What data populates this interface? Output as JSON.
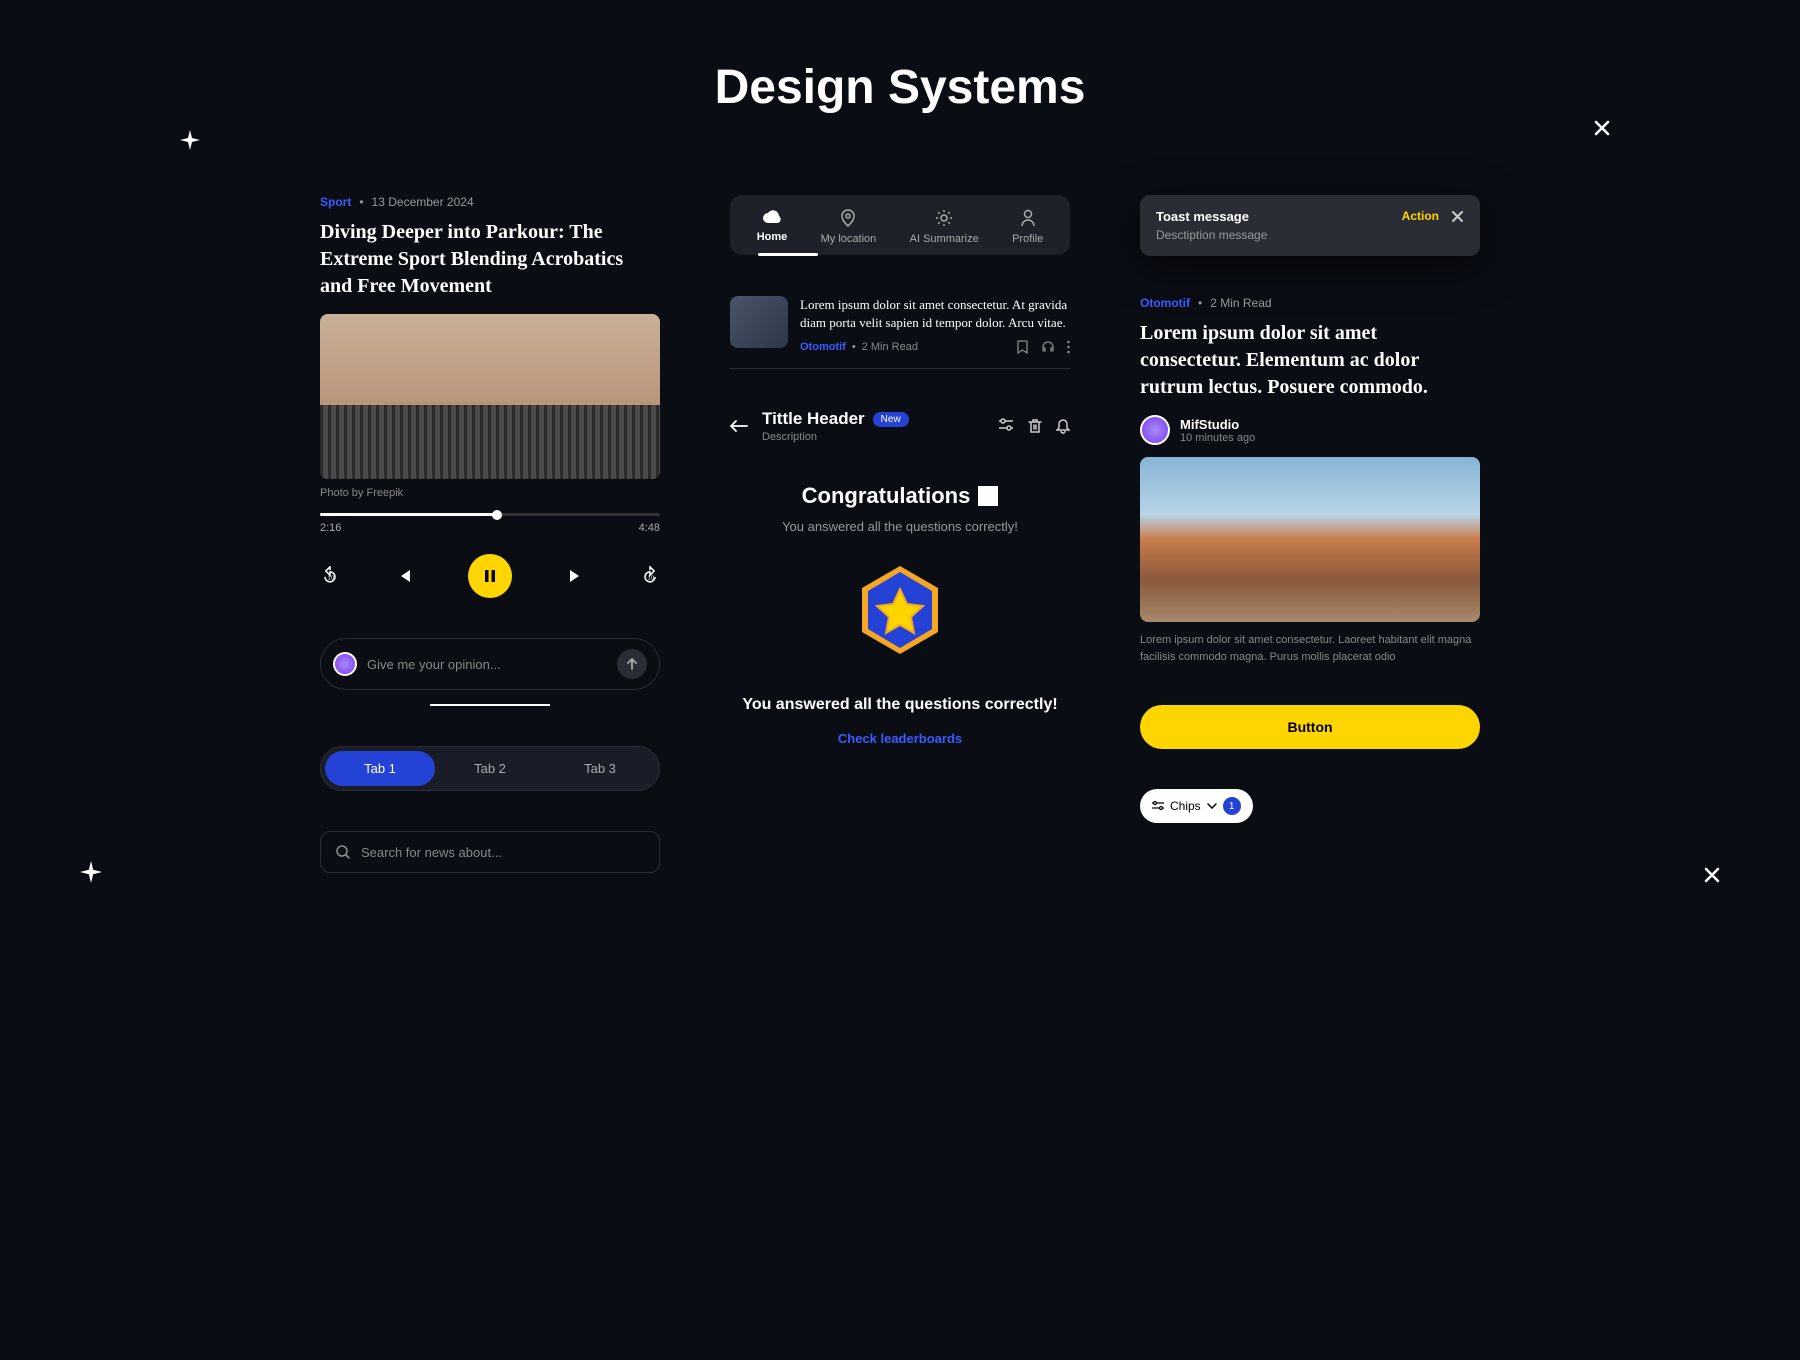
{
  "page": {
    "title": "Design Systems"
  },
  "article1": {
    "category": "Sport",
    "date": "13 December 2024",
    "title": "Diving Deeper into Parkour: The Extreme Sport Blending Acrobatics and Free Movement",
    "caption": "Photo by Freepik"
  },
  "player": {
    "elapsed": "2:16",
    "duration": "4:48"
  },
  "chat": {
    "placeholder": "Give me your opinion..."
  },
  "tabs": {
    "t1": "Tab 1",
    "t2": "Tab 2",
    "t3": "Tab 3"
  },
  "search": {
    "placeholder": "Search for news about..."
  },
  "nav": {
    "home": "Home",
    "location": "My location",
    "ai": "AI Summarize",
    "profile": "Profile"
  },
  "listItem": {
    "title": "Lorem ipsum dolor sit amet consectetur. At gravida diam porta velit sapien id tempor dolor. Arcu vitae.",
    "category": "Otomotif",
    "readtime": "2 Min Read"
  },
  "header": {
    "title": "Tittle Header",
    "badge": "New",
    "desc": "Description"
  },
  "congrats": {
    "title": "Congratulations",
    "sub": "You answered all the questions correctly!",
    "msg": "You answered all the questions correctly!",
    "link": "Check leaderboards"
  },
  "toast": {
    "title": "Toast message",
    "desc": "Desctiption message",
    "action": "Action"
  },
  "article2": {
    "category": "Otomotif",
    "readtime": "2 Min Read",
    "title": "Lorem ipsum dolor sit amet consectetur. Elementum ac dolor rutrum lectus. Posuere commodo.",
    "author": "MifStudio",
    "time": "10 minutes ago",
    "excerpt": "Lorem ipsum dolor sit amet consectetur. Laoreet habitant elit magna facilisis commodo magna. Purus mollis placerat odio"
  },
  "button": {
    "label": "Button"
  },
  "chip": {
    "label": "Chips",
    "count": "1"
  }
}
